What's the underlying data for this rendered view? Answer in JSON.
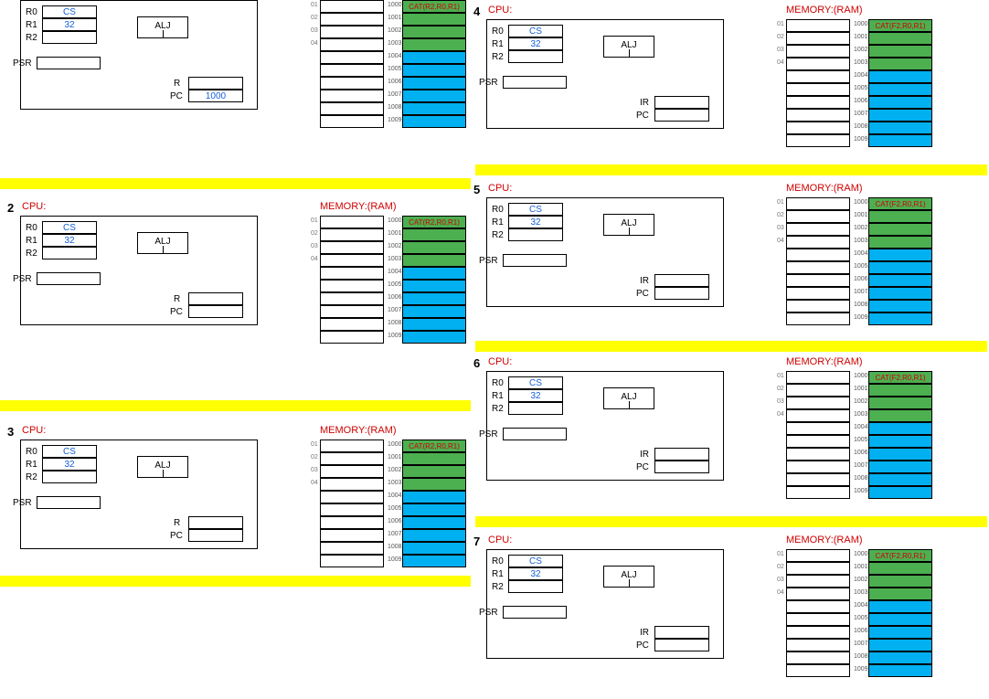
{
  "labels": {
    "cpu": "CPU:",
    "memory": "MEMORY:(RAM)",
    "R0": "R0",
    "R1": "R1",
    "R2": "R2",
    "PSR": "PSR",
    "IR": "IR",
    "R": "R",
    "PC": "PC",
    "ALJ": "ALJ"
  },
  "steps": {
    "1": {
      "R0": "CS",
      "R1": "32",
      "R2": "",
      "PSR": "",
      "IRlabel": "R",
      "IR": "",
      "PC": "1000",
      "mem_instr": "CAT(R2,R0,R1)",
      "mem_addr_start": 1000
    },
    "2": {
      "num": "2",
      "R0": "CS",
      "R1": "32",
      "R2": "",
      "PSR": "",
      "IRlabel": "R",
      "IR": "",
      "PC": "",
      "mem_instr": "CAT(R2,R0,R1)",
      "mem_addr_start": 1000
    },
    "3": {
      "num": "3",
      "R0": "CS",
      "R1": "32",
      "R2": "",
      "PSR": "",
      "IRlabel": "R",
      "IR": "",
      "PC": "",
      "mem_instr": "CAT(R2,R0,R1)",
      "mem_addr_start": 1000
    },
    "4": {
      "num": "4",
      "R0": "CS",
      "R1": "32",
      "R2": "",
      "PSR": "",
      "IRlabel": "IR",
      "IR": "",
      "PC": "",
      "mem_instr": "CAT(F2,R0,R1)",
      "mem_addr_start": 1000
    },
    "5": {
      "num": "5",
      "R0": "CS",
      "R1": "32",
      "R2": "",
      "PSR": "",
      "IRlabel": "IR",
      "IR": "",
      "PC": "",
      "mem_instr": "CAT(F2,R0,R1)",
      "mem_addr_start": 1000
    },
    "6": {
      "num": "6",
      "R0": "CS",
      "R1": "32",
      "R2": "",
      "PSR": "",
      "IRlabel": "IR",
      "IR": "",
      "PC": "",
      "mem_instr": "CAT(F2,R0,R1)",
      "mem_addr_start": 1000
    },
    "7": {
      "num": "7",
      "R0": "CS",
      "R1": "32",
      "R2": "",
      "PSR": "",
      "IRlabel": "IR",
      "IR": "",
      "PC": "",
      "mem_instr": "CAT(F2,R0,R1)",
      "mem_addr_start": 1000
    }
  },
  "memory_rows": 10,
  "memory_green_rows": 4,
  "memory_blue_rows": 6,
  "addr_labels": [
    "01",
    "02",
    "03",
    "04",
    "",
    "",
    "",
    "",
    "",
    ""
  ]
}
